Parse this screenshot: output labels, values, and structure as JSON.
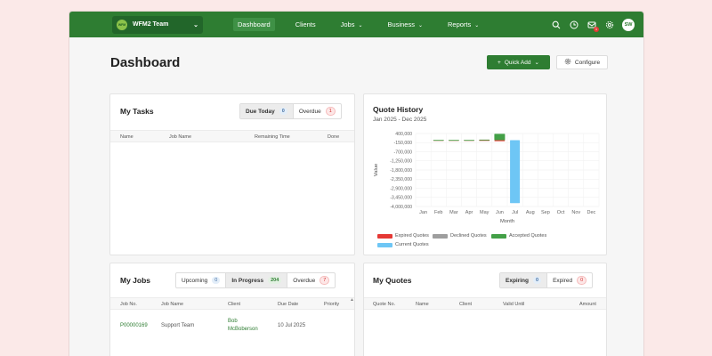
{
  "header": {
    "team": {
      "logo_text": "WFM",
      "name": "WFM2 Team"
    },
    "nav": [
      {
        "label": "Dashboard",
        "active": true,
        "dropdown": false
      },
      {
        "label": "Clients",
        "active": false,
        "dropdown": false
      },
      {
        "label": "Jobs",
        "active": false,
        "dropdown": true
      },
      {
        "label": "Business",
        "active": false,
        "dropdown": true
      },
      {
        "label": "Reports",
        "active": false,
        "dropdown": true
      }
    ],
    "icons": [
      "search-icon",
      "clock-icon",
      "inbox-icon",
      "gear-icon"
    ],
    "inbox_badge": "1",
    "avatar_initials": "SW"
  },
  "page": {
    "title": "Dashboard",
    "quick_add_label": "Quick Add",
    "configure_label": "Configure"
  },
  "my_tasks": {
    "title": "My Tasks",
    "filters": [
      {
        "label": "Due Today",
        "count": "0",
        "active": true,
        "style": "blue"
      },
      {
        "label": "Overdue",
        "count": "1",
        "active": false,
        "style": "red"
      }
    ],
    "columns": [
      "Name",
      "Job Name",
      "Remaining Time",
      "Done"
    ]
  },
  "quote_history": {
    "title": "Quote History",
    "subtitle": "Jan 2025 - Dec 2025"
  },
  "chart_data": {
    "type": "bar",
    "title": "Quote History",
    "subtitle": "Jan 2025 - Dec 2025",
    "xlabel": "Month",
    "ylabel": "Value",
    "categories": [
      "Jan",
      "Feb",
      "Mar",
      "Apr",
      "May",
      "Jun",
      "Jul",
      "Aug",
      "Sep",
      "Oct",
      "Nov",
      "Dec"
    ],
    "y_ticks": [
      "400,000",
      "-150,000",
      "-700,000",
      "-1,250,000",
      "-1,800,000",
      "-2,350,000",
      "-2,900,000",
      "-3,450,000",
      "-4,000,000"
    ],
    "ylim": [
      -4000000,
      400000
    ],
    "series": [
      {
        "name": "Expired Quotes",
        "color": "#e53935",
        "values": [
          0,
          -20000,
          -20000,
          -20000,
          -40000,
          -60000,
          0,
          0,
          0,
          0,
          0,
          0
        ]
      },
      {
        "name": "Declined Quotes",
        "color": "#9e9e9e",
        "values": [
          0,
          0,
          0,
          0,
          0,
          0,
          0,
          0,
          0,
          0,
          0,
          0
        ]
      },
      {
        "name": "Accepted Quotes",
        "color": "#43a047",
        "values": [
          0,
          10000,
          10000,
          10000,
          30000,
          380000,
          0,
          0,
          0,
          0,
          0,
          0
        ]
      },
      {
        "name": "Current Quotes",
        "color": "#6ec6f5",
        "values": [
          0,
          0,
          0,
          0,
          0,
          0,
          -3800000,
          0,
          0,
          0,
          0,
          0
        ]
      }
    ],
    "grid": true,
    "legend": "bottom"
  },
  "my_jobs": {
    "title": "My Jobs",
    "filters": [
      {
        "label": "Upcoming",
        "count": "0",
        "active": false,
        "style": "blue"
      },
      {
        "label": "In Progress",
        "count": "204",
        "active": true,
        "style": "green"
      },
      {
        "label": "Overdue",
        "count": "7",
        "active": false,
        "style": "red"
      }
    ],
    "columns": [
      "Job No.",
      "Job Name",
      "Client",
      "Due Date",
      "Priority"
    ],
    "rows": [
      {
        "job_no": "P00000169",
        "job_name": "Support Team",
        "client_line1": "Bob",
        "client_line2": "McBoberson",
        "due_date": "10 Jul 2025",
        "priority": ""
      }
    ]
  },
  "my_quotes": {
    "title": "My Quotes",
    "filters": [
      {
        "label": "Expiring",
        "count": "0",
        "active": true,
        "style": "blue"
      },
      {
        "label": "Expired",
        "count": "0",
        "active": false,
        "style": "red"
      }
    ],
    "columns": [
      "Quote No.",
      "Name",
      "Client",
      "Valid Until",
      "Amount"
    ]
  }
}
